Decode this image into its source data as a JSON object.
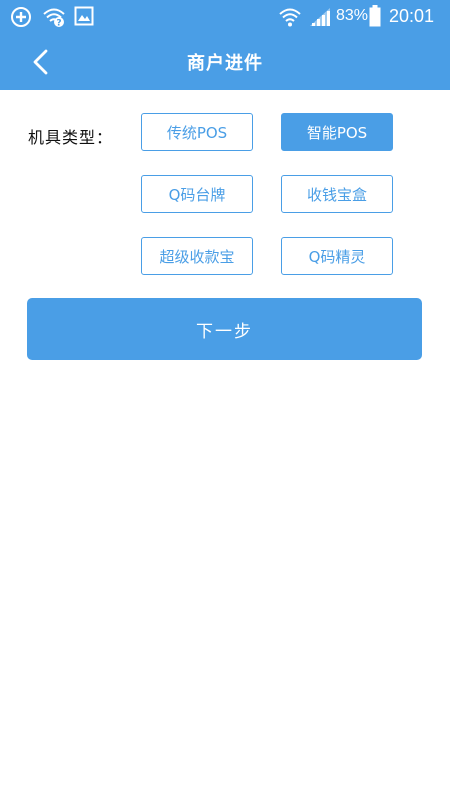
{
  "colors": {
    "accent": "#4a9ee6",
    "background": "#ffffff",
    "label_text": "#111111"
  },
  "status_bar": {
    "icons": [
      "add-circle-icon",
      "wifi-question-icon",
      "gallery-icon",
      "wifi-icon",
      "signal-icon",
      "battery-icon"
    ],
    "battery": "83%",
    "time": "20:01"
  },
  "header": {
    "back_icon": "chevron-left-icon",
    "title": "商户进件"
  },
  "form": {
    "type_label": "机具类型：",
    "options": [
      {
        "label": "传统POS",
        "selected": false
      },
      {
        "label": "智能POS",
        "selected": true
      },
      {
        "label": "Q码台牌",
        "selected": false
      },
      {
        "label": "收钱宝盒",
        "selected": false
      },
      {
        "label": "超级收款宝",
        "selected": false
      },
      {
        "label": "Q码精灵",
        "selected": false
      }
    ]
  },
  "next_button": {
    "label": "下一步"
  }
}
